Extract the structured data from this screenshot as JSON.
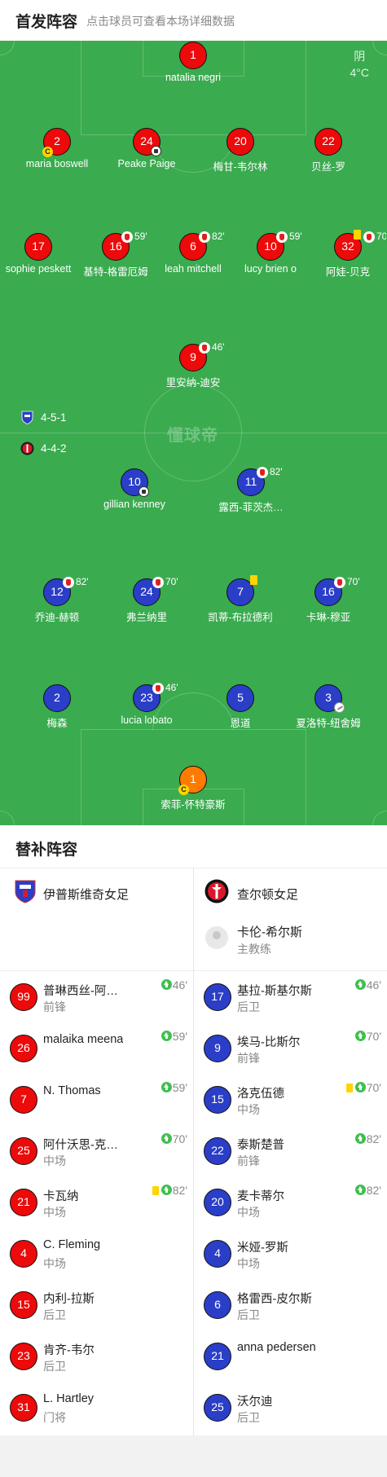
{
  "lineup_header": {
    "title": "首发阵容",
    "subtitle": "点击球员可查看本场详细数据"
  },
  "weather": {
    "condition": "阴",
    "temperature": "4°C"
  },
  "watermark": "懂球帝",
  "formations": {
    "home": "4-5-1",
    "away": "4-4-2"
  },
  "colors": {
    "red_team": "#ec0a0a",
    "blue_team": "#2b3ec8",
    "goalkeeper_away": "#ff7a00",
    "pitch": "#3aab4f"
  },
  "red_team_players": [
    {
      "number": "1",
      "name": "natalia negri"
    },
    {
      "number": "2",
      "name": "maria boswell",
      "captain": "C"
    },
    {
      "number": "24",
      "name": "Peake Paige",
      "goal": true
    },
    {
      "number": "20",
      "name": "梅甘-韦尔林"
    },
    {
      "number": "22",
      "name": "贝丝-罗"
    },
    {
      "number": "17",
      "name": "sophie peskett"
    },
    {
      "number": "16",
      "name": "基特-格雷厄姆",
      "sub_off": "59'"
    },
    {
      "number": "6",
      "name": "leah mitchell",
      "sub_off": "82'"
    },
    {
      "number": "10",
      "name": "lucy brien o",
      "sub_off": "59'"
    },
    {
      "number": "32",
      "name": "阿娃-贝克",
      "sub_off": "70'",
      "yellow_card": true
    },
    {
      "number": "9",
      "name": "里安纳-迪安",
      "sub_off": "46'"
    }
  ],
  "blue_team_players": [
    {
      "number": "10",
      "name": "gillian kenney",
      "goal": true
    },
    {
      "number": "11",
      "name": "露西-菲茨杰…",
      "sub_off": "82'"
    },
    {
      "number": "12",
      "name": "乔迪-赫顿",
      "sub_off": "82'"
    },
    {
      "number": "24",
      "name": "弗兰纳里",
      "sub_off": "70'"
    },
    {
      "number": "7",
      "name": "凯蒂-布拉德利",
      "yellow_card": true
    },
    {
      "number": "16",
      "name": "卡琳-穆亚",
      "sub_off": "70'"
    },
    {
      "number": "2",
      "name": "梅森"
    },
    {
      "number": "23",
      "name": "lucia lobato",
      "sub_off": "46'"
    },
    {
      "number": "5",
      "name": "恩道"
    },
    {
      "number": "3",
      "name": "夏洛特-纽舍姆",
      "assist": true
    },
    {
      "number": "1",
      "name": "索菲-怀特豪斯",
      "captain": "C"
    }
  ],
  "subs_header": {
    "title": "替补阵容"
  },
  "home_team": {
    "name": "伊普斯维奇女足"
  },
  "away_team": {
    "name": "查尔顿女足"
  },
  "away_coach": {
    "name": "卡伦-希尔斯",
    "role": "主教练"
  },
  "home_subs": [
    {
      "number": "99",
      "name": "普琳西丝-阿…",
      "position": "前锋",
      "sub_in": "46'"
    },
    {
      "number": "26",
      "name": "malaika meena",
      "position": "",
      "sub_in": "59'"
    },
    {
      "number": "7",
      "name": "N. Thomas",
      "position": "",
      "sub_in": "59'"
    },
    {
      "number": "25",
      "name": "阿什沃思-克…",
      "position": "中场",
      "sub_in": "70'"
    },
    {
      "number": "21",
      "name": "卡瓦纳",
      "position": "中场",
      "sub_in": "82'",
      "yellow_card": true
    },
    {
      "number": "4",
      "name": "C. Fleming",
      "position": "中场"
    },
    {
      "number": "15",
      "name": "内利-拉斯",
      "position": "后卫"
    },
    {
      "number": "23",
      "name": "肯齐-韦尔",
      "position": "后卫"
    },
    {
      "number": "31",
      "name": "L. Hartley",
      "position": "门将"
    }
  ],
  "away_subs": [
    {
      "number": "17",
      "name": "基拉-斯基尔斯",
      "position": "后卫",
      "sub_in": "46'"
    },
    {
      "number": "9",
      "name": "埃马-比斯尔",
      "position": "前锋",
      "sub_in": "70'"
    },
    {
      "number": "15",
      "name": "洛克伍德",
      "position": "中场",
      "sub_in": "70'",
      "yellow_card": true
    },
    {
      "number": "22",
      "name": "泰斯楚普",
      "position": "前锋",
      "sub_in": "82'"
    },
    {
      "number": "20",
      "name": "麦卡蒂尔",
      "position": "中场",
      "sub_in": "82'"
    },
    {
      "number": "4",
      "name": "米娅-罗斯",
      "position": "中场"
    },
    {
      "number": "6",
      "name": "格雷西-皮尔斯",
      "position": "后卫"
    },
    {
      "number": "21",
      "name": "anna pedersen",
      "position": ""
    },
    {
      "number": "25",
      "name": "沃尔迪",
      "position": "后卫"
    }
  ]
}
